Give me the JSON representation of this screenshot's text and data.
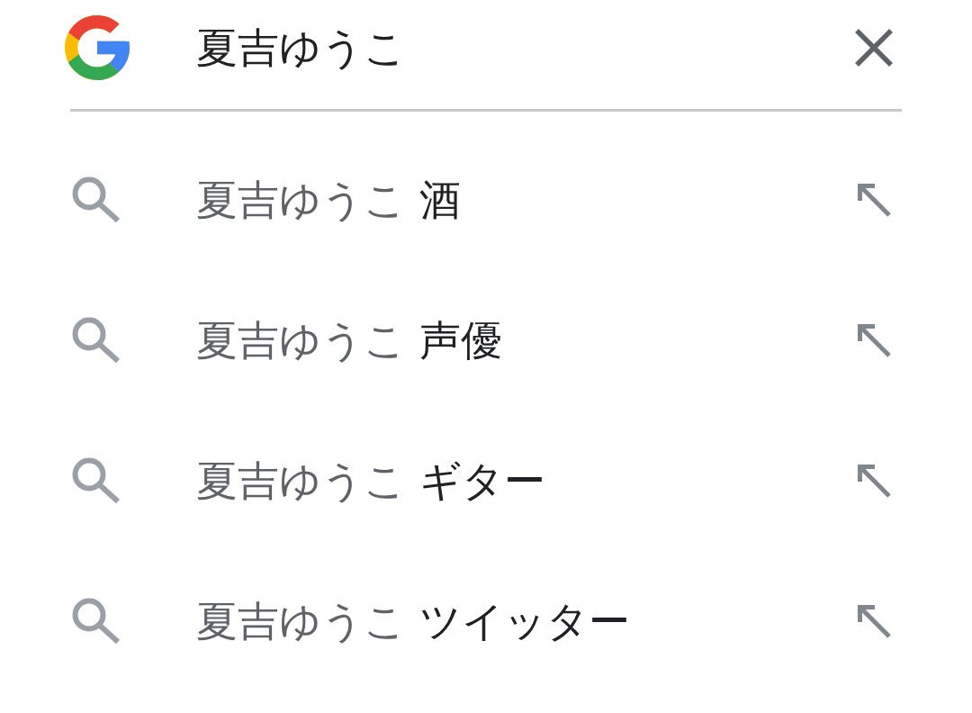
{
  "search": {
    "value": "夏吉ゆうこ"
  },
  "suggestions": [
    {
      "query": "夏吉ゆうこ",
      "completion": "酒"
    },
    {
      "query": "夏吉ゆうこ",
      "completion": "声優"
    },
    {
      "query": "夏吉ゆうこ",
      "completion": "ギター"
    },
    {
      "query": "夏吉ゆうこ",
      "completion": "ツイッター"
    }
  ]
}
